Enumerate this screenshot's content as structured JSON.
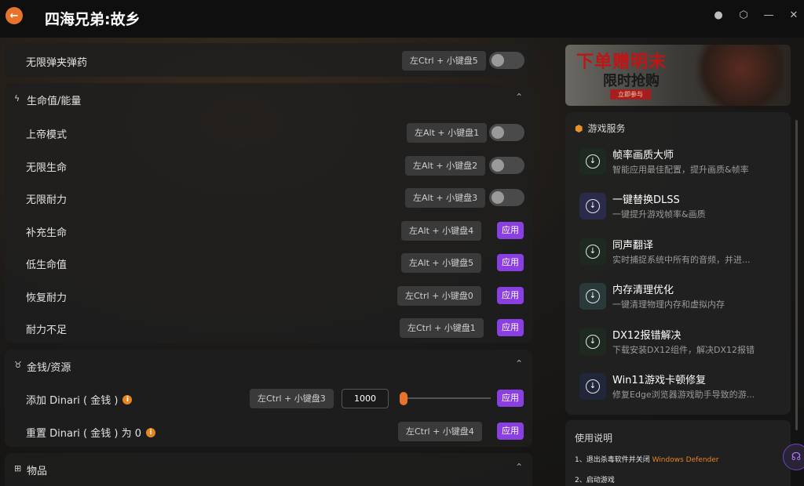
{
  "header": {
    "back_icon": "arrow-left-icon",
    "title": "四海兄弟:故乡",
    "window_controls": [
      "user-icon",
      "settings-icon",
      "minimize-icon",
      "collapse-icon"
    ]
  },
  "top_partial_row": {
    "label": "无限弹夹弹药",
    "hotkey": "左Ctrl + 小键盘5"
  },
  "section_health": {
    "title": "生命值/能量",
    "rows": [
      {
        "label": "上帝模式",
        "hotkey": "左Alt + 小键盘1",
        "control": "toggle"
      },
      {
        "label": "无限生命",
        "hotkey": "左Alt + 小键盘2",
        "control": "toggle"
      },
      {
        "label": "无限耐力",
        "hotkey": "左Alt + 小键盘3",
        "control": "toggle"
      },
      {
        "label": "补充生命",
        "hotkey": "左Alt + 小键盘4",
        "control": "apply"
      },
      {
        "label": "低生命值",
        "hotkey": "左Alt + 小键盘5",
        "control": "apply"
      },
      {
        "label": "恢复耐力",
        "hotkey": "左Ctrl + 小键盘0",
        "control": "apply"
      },
      {
        "label": "耐力不足",
        "hotkey": "左Ctrl + 小键盘1",
        "control": "apply"
      }
    ]
  },
  "section_money": {
    "title": "金钱/资源",
    "rows": [
      {
        "label": "添加 Dinari ( 金钱 )",
        "hotkey": "左Ctrl + 小键盘3",
        "input_value": "1000",
        "control": "apply"
      },
      {
        "label": "重置 Dinari ( 金钱 ) 为 0",
        "hotkey": "左Ctrl + 小键盘4",
        "control": "apply"
      }
    ]
  },
  "section_items": {
    "title": "物品"
  },
  "apply_label": "应用",
  "banner": {
    "headline": "下单赠明末",
    "subline": "限时抢购",
    "button": "立即参与"
  },
  "services": {
    "title": "游戏服务",
    "items": [
      {
        "title": "帧率画质大师",
        "desc": "智能应用最佳配置，提升画质&帧率"
      },
      {
        "title": "一键替换DLSS",
        "desc": "一键提升游戏帧率&画质"
      },
      {
        "title": "同声翻译",
        "desc": "实时捕捉系统中所有的音频，并进..."
      },
      {
        "title": "内存清理优化",
        "desc": "一键清理物理内存和虚拟内存"
      },
      {
        "title": "DX12报错解决",
        "desc": "下载安装DX12组件，解决DX12报错"
      },
      {
        "title": "Win11游戏卡顿修复",
        "desc": "修复Edge浏览器游戏助手导致的游..."
      }
    ]
  },
  "usage": {
    "title": "使用说明",
    "step1_prefix": "1、退出杀毒软件并关闭",
    "step1_highlight": "Windows Defender",
    "step2": "2、启动游戏"
  },
  "colors": {
    "accent_orange": "#e8732a",
    "apply_purple": "#8a3fe0"
  }
}
